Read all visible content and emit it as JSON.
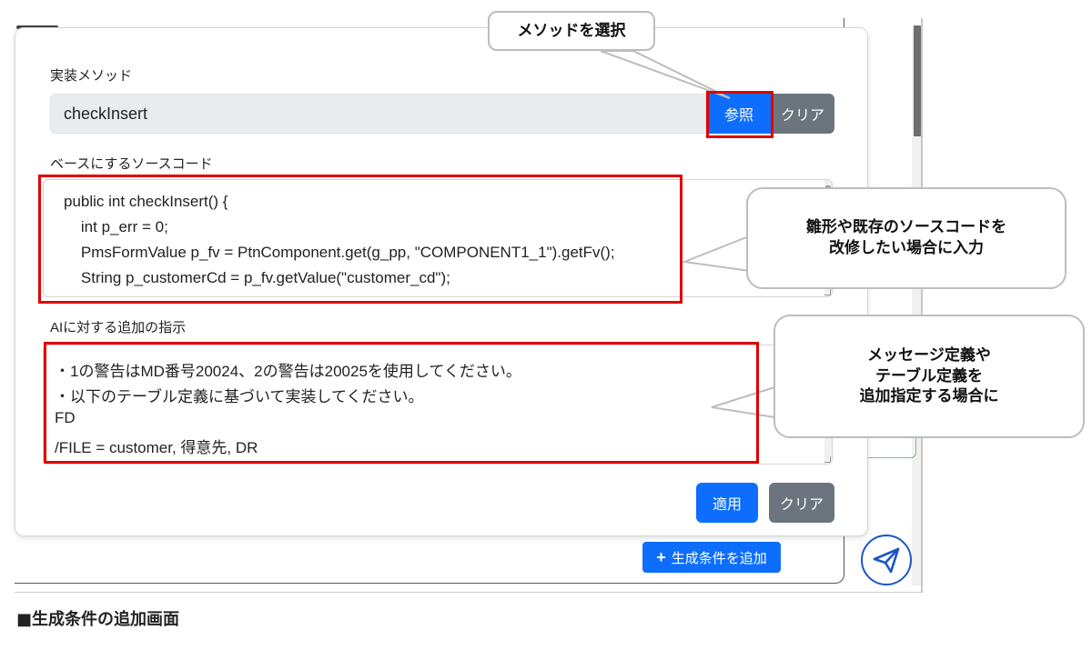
{
  "page": {
    "caption": "■生成条件の追加画面"
  },
  "background": {
    "add_condition_label": "生成条件を追加",
    "add_condition_icon": "plus-icon",
    "send_icon": "paper-plane-icon"
  },
  "dialog": {
    "method_label": "実装メソッド",
    "method_value": "checkInsert",
    "reference_button": "参照",
    "clear_button": "クリア",
    "base_source_label": "ベースにするソースコード",
    "source_lines": [
      "public int checkInsert() {",
      "    int p_err = 0;",
      "    PmsFormValue p_fv = PtnComponent.get(g_pp, \"COMPONENT1_1\").getFv();",
      "    String p_customerCd = p_fv.getValue(\"customer_cd\");"
    ],
    "instruction_label": "AIに対する追加の指示",
    "instruction_lines": [
      "・1の警告はMD番号20024、2の警告は20025を使用してください。",
      "・以下のテーブル定義に基づいて実装してください。",
      "FD",
      "/FILE = customer, 得意先, DR"
    ],
    "apply_button": "適用",
    "clear_button_2": "クリア"
  },
  "annotations": {
    "select_method": "メソッドを選択",
    "source_note_lines": [
      "雛形や既存のソースコードを",
      "改修したい場合に入力"
    ],
    "instruction_note_lines": [
      "メッセージ定義や",
      "テーブル定義を",
      "追加指定する場合に"
    ],
    "highlight_color": "#e00000"
  }
}
